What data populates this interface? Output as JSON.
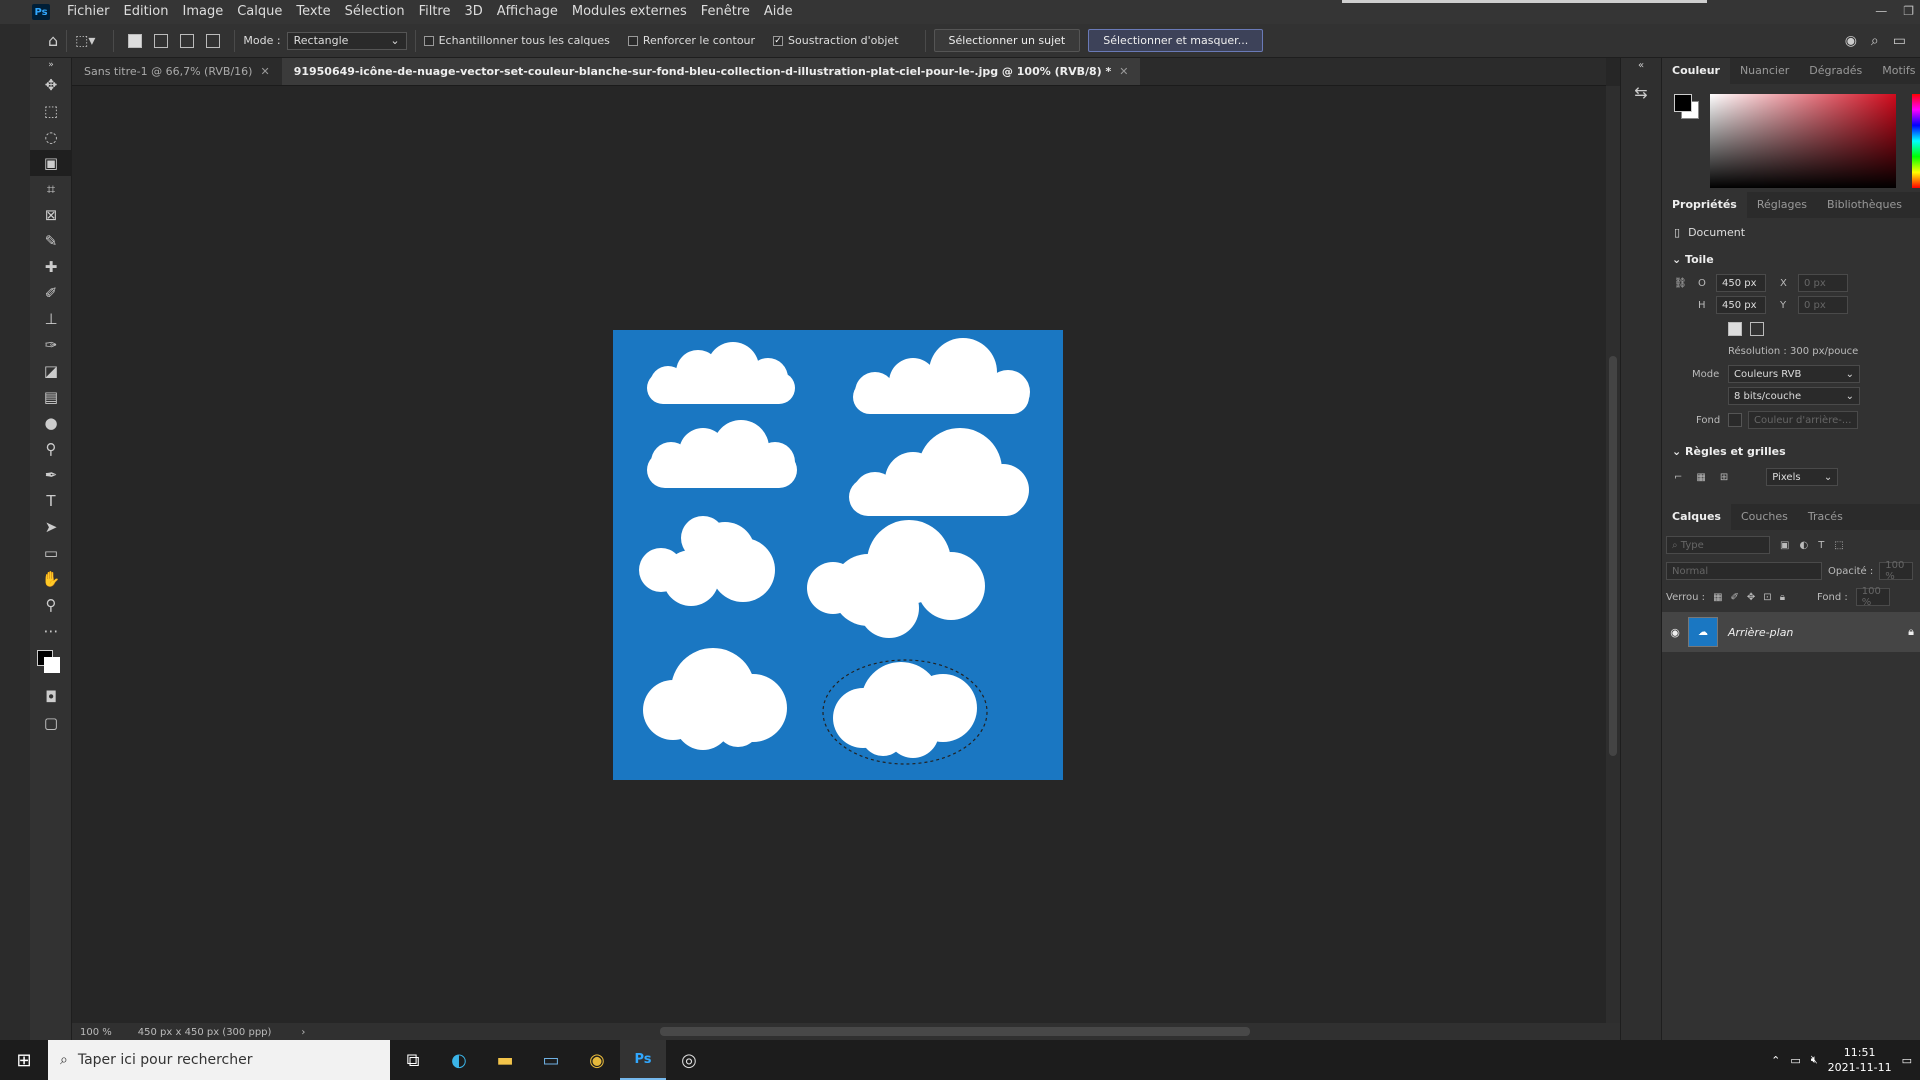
{
  "app": {
    "logo": "Ps"
  },
  "menu": [
    "Fichier",
    "Edition",
    "Image",
    "Calque",
    "Texte",
    "Sélection",
    "Filtre",
    "3D",
    "Affichage",
    "Modules externes",
    "Fenêtre",
    "Aide"
  ],
  "options": {
    "mode_label": "Mode :",
    "mode_value": "Rectangle",
    "sample_all": "Echantillonner tous les calques",
    "enhance_edge": "Renforcer le contour",
    "object_subtract": "Soustraction d'objet",
    "select_subject": "Sélectionner un sujet",
    "select_mask": "Sélectionner et masquer..."
  },
  "tabs": [
    {
      "label": "Sans titre-1 @ 66,7% (RVB/16)"
    },
    {
      "label": "91950649-icône-de-nuage-vector-set-couleur-blanche-sur-fond-bleu-collection-d-illustration-plat-ciel-pour-le-.jpg @ 100% (RVB/8) *"
    }
  ],
  "status": {
    "zoom": "100 %",
    "info": "450 px x 450 px (300 ppp)"
  },
  "panel": {
    "color_tabs": [
      "Couleur",
      "Nuancier",
      "Dégradés",
      "Motifs"
    ],
    "prop_tabs": [
      "Propriétés",
      "Réglages",
      "Bibliothèques"
    ],
    "document": "Document",
    "canvas_title": "Toile",
    "w_label": "O",
    "w_value": "450 px",
    "h_label": "H",
    "h_value": "450 px",
    "x_label": "X",
    "x_value": "0 px",
    "y_label": "Y",
    "y_value": "0 px",
    "resolution": "Résolution : 300 px/pouce",
    "mode_label": "Mode",
    "mode_value": "Couleurs RVB",
    "depth_value": "8 bits/couche",
    "fill_label": "Fond",
    "fill_value": "Couleur d'arrière-...",
    "grid_title": "Règles et grilles",
    "units": "Pixels",
    "layer_tabs": [
      "Calques",
      "Couches",
      "Tracés"
    ],
    "type_placeholder": "Type",
    "blend": "Normal",
    "opacity_label": "Opacité :",
    "opacity": "100 %",
    "lock_label": "Verrou :",
    "fill2_label": "Fond :",
    "fill2": "100 %",
    "layer_name": "Arrière-plan"
  },
  "taskbar": {
    "search_placeholder": "Taper ici pour rechercher",
    "time": "11:51",
    "date": "2021-11-11"
  },
  "colors": {
    "canvas_bg": "#1a77c2",
    "fg": "#000000",
    "bg": "#ffffff"
  }
}
